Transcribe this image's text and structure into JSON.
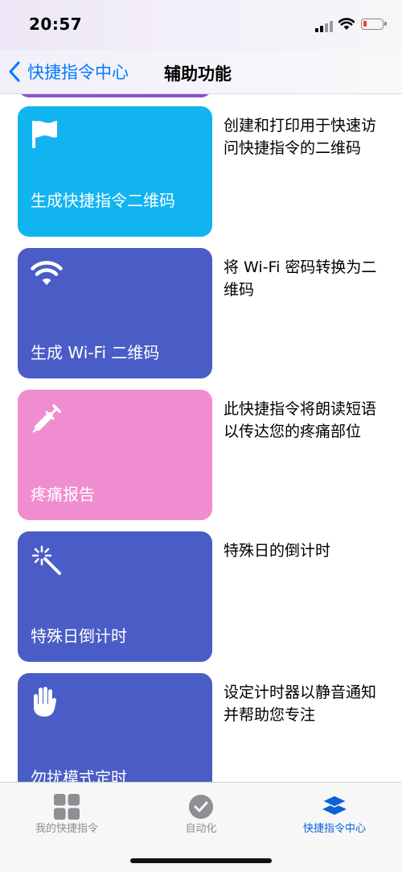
{
  "status": {
    "time": "20:57"
  },
  "nav": {
    "back_label": "快捷指令中心",
    "title": "辅助功能"
  },
  "shortcuts": [
    {
      "title": "生成快捷指令二维码",
      "desc": "创建和打印用于快速访问快捷指令的二维码",
      "icon": "flag-icon",
      "color": "#12b4f0"
    },
    {
      "title": "生成 Wi-Fi 二维码",
      "desc": "将 Wi-Fi 密码转换为二维码",
      "icon": "wifi-icon",
      "color": "#4a5dc6"
    },
    {
      "title": "疼痛报告",
      "desc": "此快捷指令将朗读短语以传达您的疼痛部位",
      "icon": "syringe-icon",
      "color": "#f08dd0"
    },
    {
      "title": "特殊日倒计时",
      "desc": "特殊日的倒计时",
      "icon": "magic-wand-icon",
      "color": "#4a5dc6"
    },
    {
      "title": "勿扰模式定时",
      "desc": "设定计时器以静音通知并帮助您专注",
      "icon": "hand-icon",
      "color": "#4a5dc6"
    }
  ],
  "tabs": [
    {
      "label": "我的快捷指令",
      "icon": "grid-icon"
    },
    {
      "label": "自动化",
      "icon": "clock-icon"
    },
    {
      "label": "快捷指令中心",
      "icon": "layers-icon",
      "active": true
    }
  ]
}
